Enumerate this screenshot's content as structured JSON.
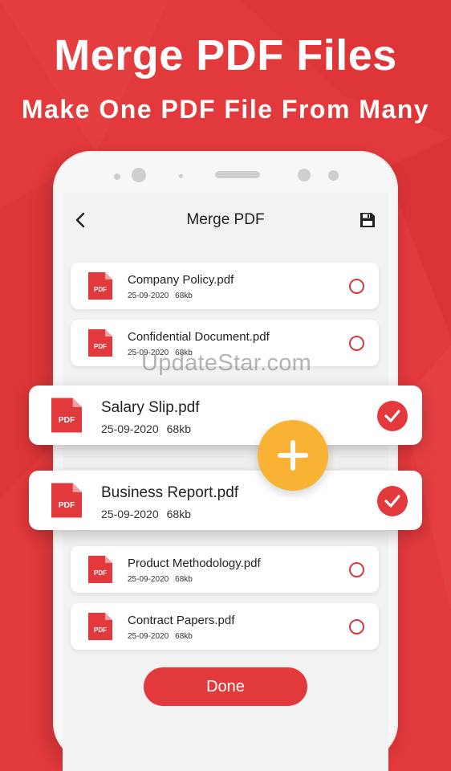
{
  "colors": {
    "brand_red": "#e2393c",
    "accent_yellow": "#f9b233",
    "card_bg": "#ffffff",
    "screen_bg": "#f2f2f2"
  },
  "promo": {
    "headline": "Merge PDF Files",
    "subheadline": "Make One PDF File From Many"
  },
  "appbar": {
    "title": "Merge PDF",
    "back_icon": "chevron-left-icon",
    "save_icon": "floppy-save-icon"
  },
  "files": [
    {
      "name": "Company Policy.pdf",
      "date": "25-09-2020",
      "size": "68kb",
      "icon_label": "PDF",
      "selected": false
    },
    {
      "name": "Confidential Document.pdf",
      "date": "25-09-2020",
      "size": "68kb",
      "icon_label": "PDF",
      "selected": false
    },
    {
      "name": "Salary Slip.pdf",
      "date": "25-09-2020",
      "size": "68kb",
      "icon_label": "PDF",
      "selected": true
    },
    {
      "name": "Business Report.pdf",
      "date": "25-09-2020",
      "size": "68kb",
      "icon_label": "PDF",
      "selected": true
    },
    {
      "name": "Product Methodology.pdf",
      "date": "25-09-2020",
      "size": "68kb",
      "icon_label": "PDF",
      "selected": false
    },
    {
      "name": "Contract Papers.pdf",
      "date": "25-09-2020",
      "size": "68kb",
      "icon_label": "PDF",
      "selected": false
    }
  ],
  "merge_button_icon": "plus-icon",
  "done_label": "Done",
  "watermark": "UpdateStar.com"
}
